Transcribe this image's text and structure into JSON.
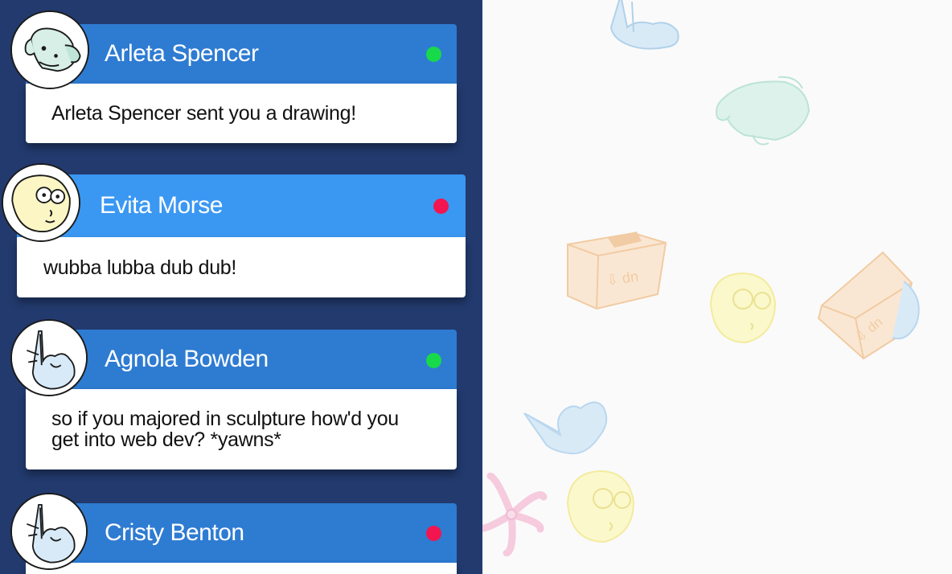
{
  "conversations": [
    {
      "name": "Arleta Spencer",
      "message": "Arleta Spencer sent you a drawing!",
      "status": "online",
      "avatar": "dog-icon"
    },
    {
      "name": "Evita Morse",
      "message": "wubba lubba dub dub!",
      "status": "busy",
      "avatar": "morty-face-icon"
    },
    {
      "name": "Agnola Bowden",
      "message": "so if you majored in sculpture how'd you get into web dev? *yawns*",
      "status": "online",
      "avatar": "hand-gesture-icon"
    },
    {
      "name": "Cristy Benton",
      "message": "",
      "status": "busy",
      "avatar": "hand-gesture-icon"
    }
  ],
  "colors": {
    "sidebar_bg": "#223a6e",
    "header": "#2e7bd2",
    "header_active": "#3a98f2",
    "online": "#18d94a",
    "busy": "#f2154f"
  }
}
